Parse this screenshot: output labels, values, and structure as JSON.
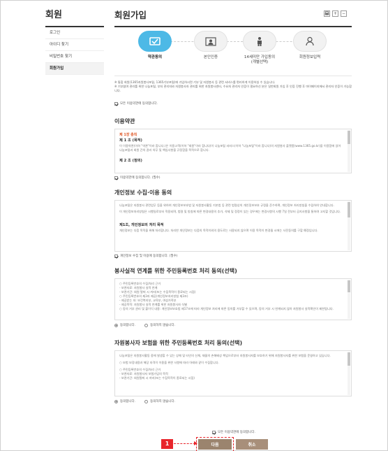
{
  "sidebar": {
    "title": "회원",
    "items": [
      {
        "label": "로그인",
        "active": false
      },
      {
        "label": "아이디 찾기",
        "active": false
      },
      {
        "label": "비밀번호 찾기",
        "active": false
      },
      {
        "label": "회원가입",
        "active": true
      }
    ]
  },
  "main": {
    "title": "회원가입",
    "tools": [
      "print-icon",
      "zoom-in-icon",
      "zoom-out-icon"
    ],
    "tool_labels": [
      "",
      "+",
      "−"
    ]
  },
  "steps": [
    {
      "label": "약관동의",
      "sub": "",
      "icon": "agreement-icon",
      "active": true
    },
    {
      "label": "본인인증",
      "sub": "",
      "icon": "identity-card-icon",
      "active": false
    },
    {
      "label": "14세미만 가입동의",
      "sub": "(개별선택)",
      "icon": "child-icon",
      "active": false
    },
    {
      "label": "회원정보입력",
      "sub": "",
      "icon": "user-icon",
      "active": false
    }
  ],
  "notices": [
    "※ 통합 회원(1365자원봉사포털, 1365기부포털)에 가입하시면 기부 및 자원봉사 등 관련 서비스를 편리하게 이용하실 수 있습니다.",
    "※ 기부참여 관리를 위한 나눔포털, 부처 관리자와 자원봉사자 관리를 위한 자원봉사센터, 수요처 관리자 인증이 필요하신 분은 일반회원 가입 후 인증 진행 후 마이페이지에서 관리자 인증이 가능합니다."
  ],
  "agree_all_top": "모든 이용약관에 동의합니다.",
  "terms": {
    "title": "이용약관",
    "chapter": "제 1장 총칙",
    "article1": "제 1 조 (목적)",
    "article1_body": "이 이용약관(이하 \"약관\"이라 합니다.)은 이용고객(이하 \"회원\"이라 합니다)이 나눔포털 서비스(이하 \"나눔포털\"이라 합니다)의 자원봉사 플랫폼(www.1365.go.kr)을 이용함에 있어 나눔포털과 회원 간의 권리 의무 및 책임사항을 규정함을 목적으로 합니다.",
    "article2": "제 2 조 (정의)",
    "agree": "이용약관에 동의합니다. (필수)"
  },
  "privacy": {
    "title": "개인정보 수집·이용 동의",
    "body1": "나눔포털은 자원봉사 관련업무 등을 위하여 개인정보보호법 및 자원봉사활동 기본법 등 관련 법령상의 개인정보보호 규정을 준수하며, 개인정보 처리방침을 수립하여 안내합니다.",
    "body2": "이 개인정보처리방침은 시행일로부터 적용되며, 법령 및 방침에 따른 변경내용의 추가, 삭제 및 정정이 있는 경우에는 변경사항의 시행 7일 전부터 공지사항을 통하여 고지할 것입니다.",
    "sub": "제1조, 개인정보의 처리 목적",
    "sub_body": "개인정보는 다음 목적을 위해 처리합니다. 처리한 개인정보는 다음의 목적이외의 용도로는 사용되지 않으며 이용 목적이 변경될 시에는 사전동의를 구할 예정입니다.",
    "agree": "개인정보 수집 및 이용에 동의합니다. (필수)"
  },
  "resident_volunteer": {
    "title": "봉사실적 연계를 위한 주민등록번호 처리 동의(선택)",
    "lines": [
      "○ 주민등록번호의 수집/처리 근거",
      "- 보관자료: 자원봉사 실적 연계",
      "- 보관기간: 회원 탈퇴 시 까지(또는 수집목적이 종료되는 시점)",
      "○ 주민등록번호의 제3자 제공(개인정보처리방침 제3조)",
      "- 제공받는 자: 보건복지부, 교육부, 여성가족부",
      "- 제공목적: 자원봉사 실적 연계를 위한 자원봉사자 식별",
      "○ 동의 거부 권리 및 불이익 내용: 개인정보보호법 제17조에 따라 개인정보 처리에 따른 동의를 거부할 수 있으며, 동의 거부 시 연계되지 않아 자원봉사 실적확인이 제한됩니다."
    ],
    "agree": "동의합니다.",
    "disagree": "동의하지 않습니다."
  },
  "resident_insurance": {
    "title": "자원봉사자 보험을 위한 주민등록번호 처리 동의(선택)",
    "lines": [
      "나눔포털은 자원봉사활동 중에 발생할 수 있는 상해 및 타인의 신체, 재물의 손해배상 책임으로부터 자원봉사자를 보호하기 위해 자원봉사자를 위한 보험을 운영하고 있습니다.",
      "○ 보험 보장내용과 해당 자격이 이용을 위한 사항에 따라 아래와 같이 수집합니다.",
      "○ 주민등록번호의 수집/처리 근거",
      "- 보관자료: 자원봉사자 보험가입의 목적",
      "- 보관기간: 회원탈퇴 시 까지(또는 수집목적이 종료되는 시점)"
    ],
    "agree": "동의합니다.",
    "disagree": "동의하지 않습니다."
  },
  "agree_all_bottom": "모든 이용약관에 동의합니다.",
  "buttons": {
    "next": "다음",
    "cancel": "취소"
  },
  "annotation": {
    "number": "1"
  },
  "colors": {
    "active_step": "#4db9e6",
    "button": "#9b846e",
    "highlight": "#e8252b",
    "chapter": "#e05a2a"
  }
}
